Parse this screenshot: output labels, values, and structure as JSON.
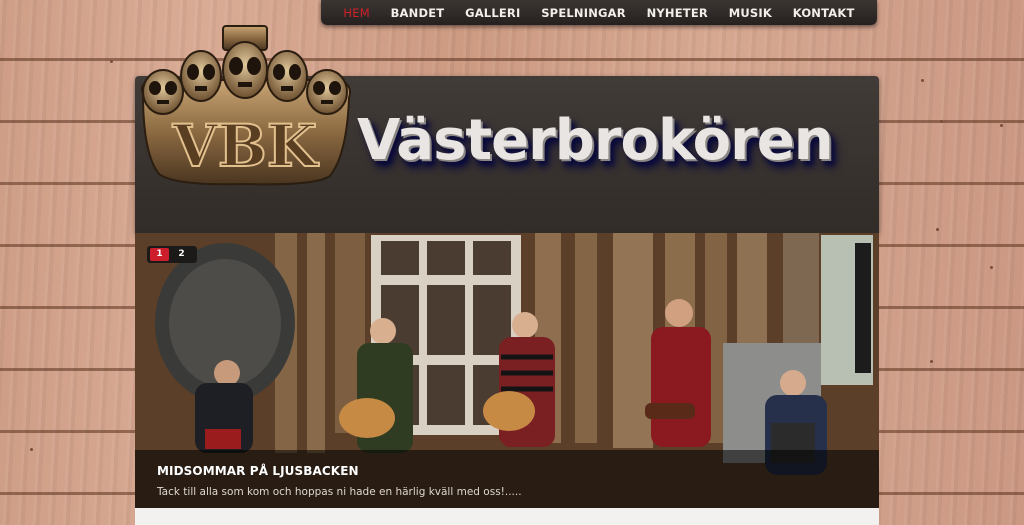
{
  "nav": {
    "items": [
      {
        "label": "HEM",
        "active": true
      },
      {
        "label": "BANDET"
      },
      {
        "label": "GALLERI"
      },
      {
        "label": "SPELNINGAR"
      },
      {
        "label": "NYHETER"
      },
      {
        "label": "MUSIK"
      },
      {
        "label": "KONTAKT"
      }
    ]
  },
  "header": {
    "logo_text": "VBK",
    "site_title": "Västerbrokören"
  },
  "slider": {
    "pages": [
      "1",
      "2"
    ],
    "active_page": "1",
    "caption_title": "MIDSOMMAR PÅ LJUSBACKEN",
    "caption_text": "Tack till alla som kom och hoppas ni hade en härlig kväll med oss!....."
  },
  "colors": {
    "accent": "#cc1f2b",
    "nav_bg": "#2e2826",
    "header_bg": "#3a3431",
    "wood": "#d3a28b"
  }
}
